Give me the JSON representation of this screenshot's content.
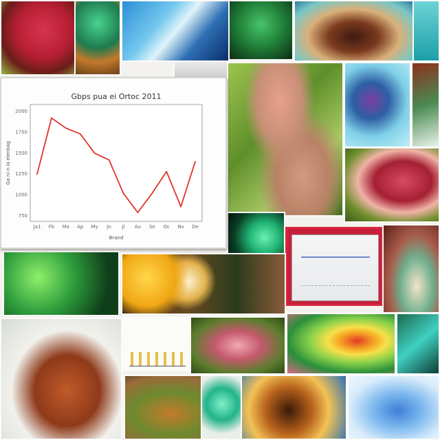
{
  "chart_data": {
    "type": "line",
    "title": "Gbps pua ei Ortoc 2011",
    "xlabel": "Brand",
    "ylabel": "Ga ni n la elenbag",
    "categories": [
      "Ja1",
      "Fb",
      "Ma",
      "Ap",
      "My",
      "Jn",
      "Jl",
      "Au",
      "Se",
      "Oc",
      "Nv",
      "De"
    ],
    "y_tick_labels": [
      "2000",
      "1750",
      "1500",
      "1250",
      "1000",
      "750"
    ],
    "ylim": [
      750,
      2000
    ],
    "series": [
      {
        "values": [
          1250,
          1920,
          1800,
          1730,
          1500,
          1420,
          1020,
          790,
          1020,
          1280,
          860,
          1400
        ],
        "color": "#e0332a"
      }
    ],
    "grid": false
  },
  "colors": {
    "line": "#e0332a",
    "frame_bg": "#ffffff"
  }
}
